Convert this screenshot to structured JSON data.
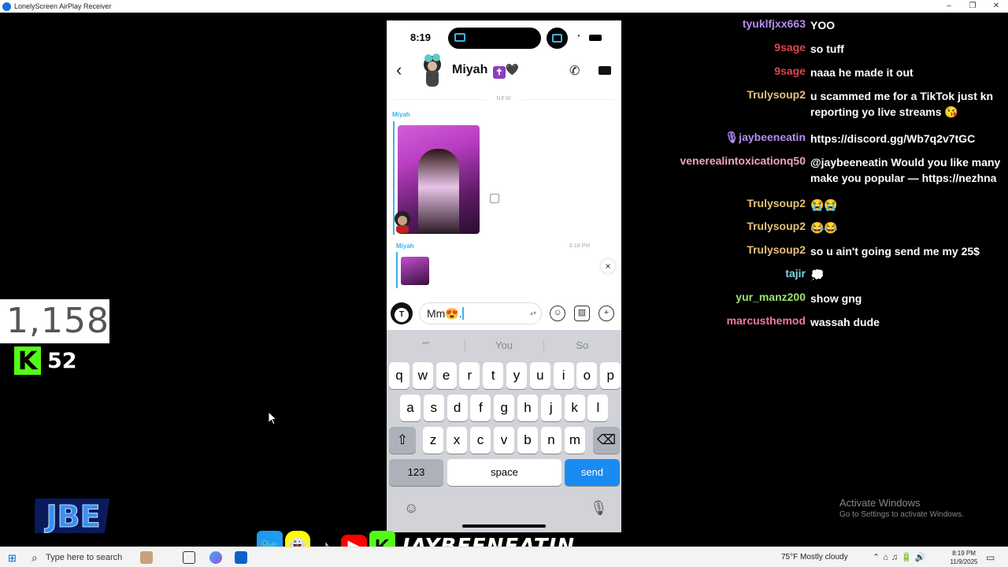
{
  "window": {
    "title": "LonelyScreen AirPlay Receiver",
    "controls": [
      "–",
      "❐",
      "✕"
    ]
  },
  "stream": {
    "viewer_count": "1,158",
    "kick_follower_count": "52",
    "kick_logo_glyph": "K",
    "logo_text": "JBE"
  },
  "phone": {
    "time": "8:19",
    "contact_name": "Miyah",
    "name_badges": [
      "✝",
      "🖤"
    ],
    "new_divider": "NEW",
    "sender_1": "Miyah",
    "sender_2": "Miyah",
    "timestamp": "8:18 PM",
    "composer_value": "Mm😍.",
    "composer_stepper": "▴▾",
    "suggestions": [
      "“”",
      "You",
      "So"
    ],
    "keys_row1": [
      "q",
      "w",
      "e",
      "r",
      "t",
      "y",
      "u",
      "i",
      "o",
      "p"
    ],
    "keys_row2": [
      "a",
      "s",
      "d",
      "f",
      "g",
      "h",
      "j",
      "k",
      "l"
    ],
    "keys_row3": [
      "z",
      "x",
      "c",
      "v",
      "b",
      "n",
      "m"
    ],
    "shift_key": "⇧",
    "delete_key": "⌫",
    "numbers_key": "123",
    "space_key": "space",
    "send_key": "send"
  },
  "chat": [
    {
      "user": "tyuklfjxx663",
      "message": "YOO",
      "color": "#b58cf5"
    },
    {
      "user": "9sage",
      "message": "so tuff",
      "color": "#e0424b"
    },
    {
      "user": "9sage",
      "message": "naaa he made it out",
      "color": "#e0424b"
    },
    {
      "user": "Trulysoup2",
      "message": "u scammed me for a TikTok just kn reporting yo live streams 😘",
      "color": "#e8c07a"
    },
    {
      "user": "🎙jaybeeneatin",
      "message": "https://discord.gg/Wb7q2v7tGC",
      "color": "#b58cf5"
    },
    {
      "user": "venerealintoxicationq50",
      "message": "@jaybeeneatin Would you like many make you popular — https://nezhna",
      "color": "#f2a3c2"
    },
    {
      "user": "Trulysoup2",
      "message": "😭😭",
      "color": "#e8c07a"
    },
    {
      "user": "Trulysoup2",
      "message": "😂😂",
      "color": "#e8c07a"
    },
    {
      "user": "Trulysoup2",
      "message": "so u ain't going send me my 25$",
      "color": "#e8c07a"
    },
    {
      "user": "tajir",
      "message": "💭",
      "color": "#7fd6e8"
    },
    {
      "user": "yur_manz200",
      "message": "show gng",
      "color": "#9be36e"
    },
    {
      "user": "marcusthemod",
      "message": "wassah dude",
      "color": "#f27a9a"
    }
  ],
  "windows_notice": {
    "title": "Activate Windows",
    "subtitle": "Go to Settings to activate Windows."
  },
  "socials": {
    "handle": "JAYBEENEATIN",
    "icons": [
      "twitter-icon",
      "snapchat-icon",
      "tiktok-icon",
      "youtube-icon",
      "kick-icon"
    ]
  },
  "taskbar": {
    "search_placeholder": "Type here to search",
    "weather": "75°F  Mostly cloudy",
    "time": "8:19 PM",
    "date": "11/9/2025"
  }
}
